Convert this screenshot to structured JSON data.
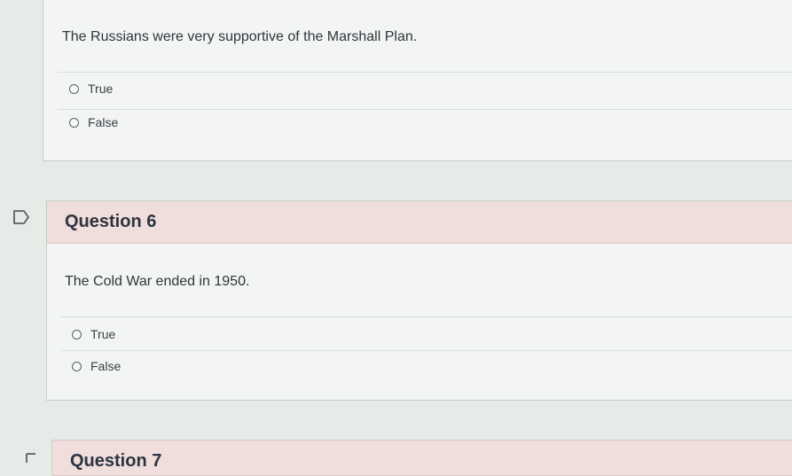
{
  "questions": [
    {
      "text": "The Russians were very supportive of the Marshall Plan.",
      "options": [
        "True",
        "False"
      ]
    },
    {
      "title": "Question 6",
      "text": "The Cold War ended in 1950.",
      "options": [
        "True",
        "False"
      ]
    },
    {
      "title": "Question 7"
    }
  ]
}
